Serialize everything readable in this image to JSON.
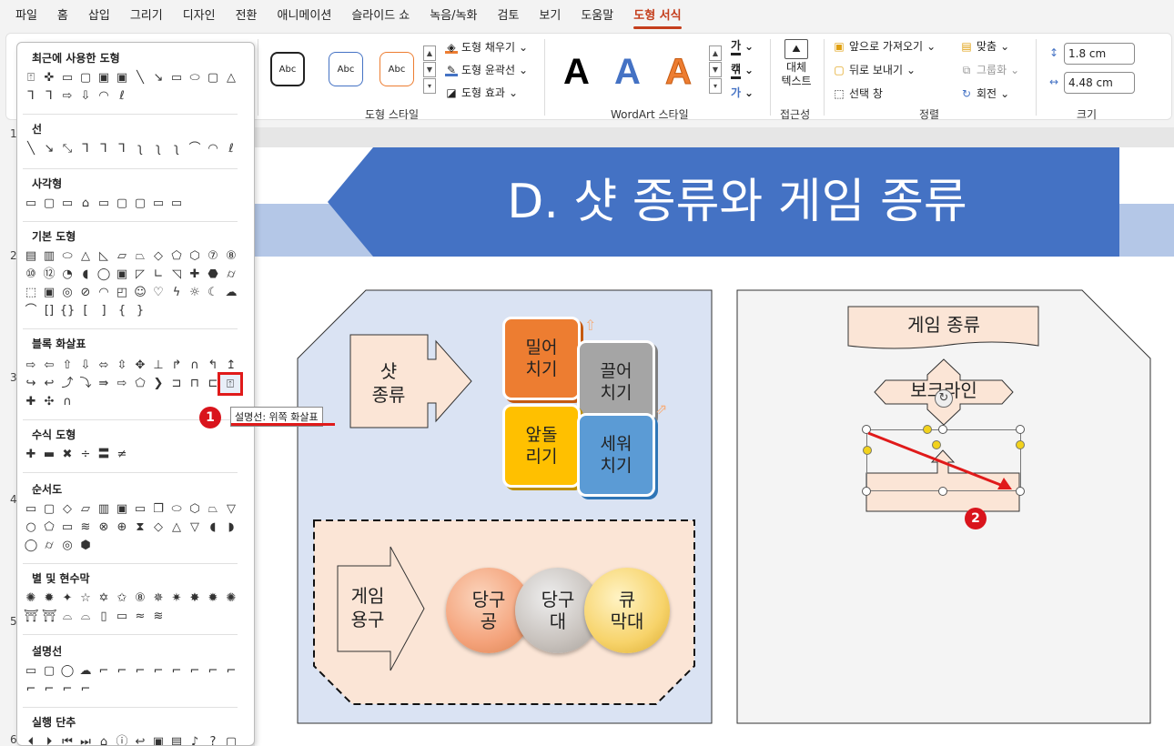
{
  "menubar": {
    "items": [
      "파일",
      "홈",
      "삽입",
      "그리기",
      "디자인",
      "전환",
      "애니메이션",
      "슬라이드 쇼",
      "녹음/녹화",
      "검토",
      "보기",
      "도움말",
      "도형 서식"
    ]
  },
  "ribbon": {
    "shape_style_samples": [
      "Abc",
      "Abc",
      "Abc"
    ],
    "fill_label": "도형 채우기",
    "outline_label": "도형 윤곽선",
    "effect_label": "도형 효과",
    "shape_styles_group": "도형 스타일",
    "wordart_letters": [
      "A",
      "A",
      "A"
    ],
    "wordart_group": "WordArt 스타일",
    "text_ga": "가",
    "text_kak": "캒",
    "text_ga2": "가",
    "alt_text_line1": "대체",
    "alt_text_line2": "텍스트",
    "accessibility_group": "접근성",
    "bring_forward": "앞으로 가져오기",
    "send_backward": "뒤로 보내기",
    "selection_pane": "선택 창",
    "align": "맞춤",
    "group": "그룹화",
    "rotate": "회전",
    "arrange_group": "정렬",
    "height": "1.8 cm",
    "width": "4.48 cm",
    "size_group": "크기"
  },
  "shape_panel": {
    "recent": "최근에 사용한 도형",
    "lines": "선",
    "rectangles": "사각형",
    "basic": "기본 도형",
    "block_arrows": "블록 화살표",
    "equation": "수식 도형",
    "flowchart": "순서도",
    "stars": "별 및 현수막",
    "callouts": "설명선",
    "action_buttons": "실행 단추",
    "tooltip": "설명선: 위쪽 화살표"
  },
  "badges": {
    "one": "1",
    "two": "2"
  },
  "ruler": [
    "1",
    "2",
    "3",
    "4",
    "5",
    "6"
  ],
  "slide": {
    "title": "D. 샷 종류와 게임 종류",
    "shot_kind": [
      "샷",
      "종류"
    ],
    "cubes": [
      [
        "밀어",
        "치기"
      ],
      [
        "끌어",
        "치기"
      ],
      [
        "앞돌",
        "리기"
      ],
      [
        "세워",
        "치기"
      ]
    ],
    "equipment": [
      "게임",
      "용구"
    ],
    "coins": [
      [
        "당구",
        "공"
      ],
      [
        "당구",
        "대"
      ],
      [
        "큐",
        "막대"
      ]
    ],
    "game_kind": "게임 종류",
    "bowling": "보크라인"
  },
  "colors": {
    "title_band": "#4472c4",
    "accent": "#c43e1c",
    "badge": "#d9141c"
  }
}
